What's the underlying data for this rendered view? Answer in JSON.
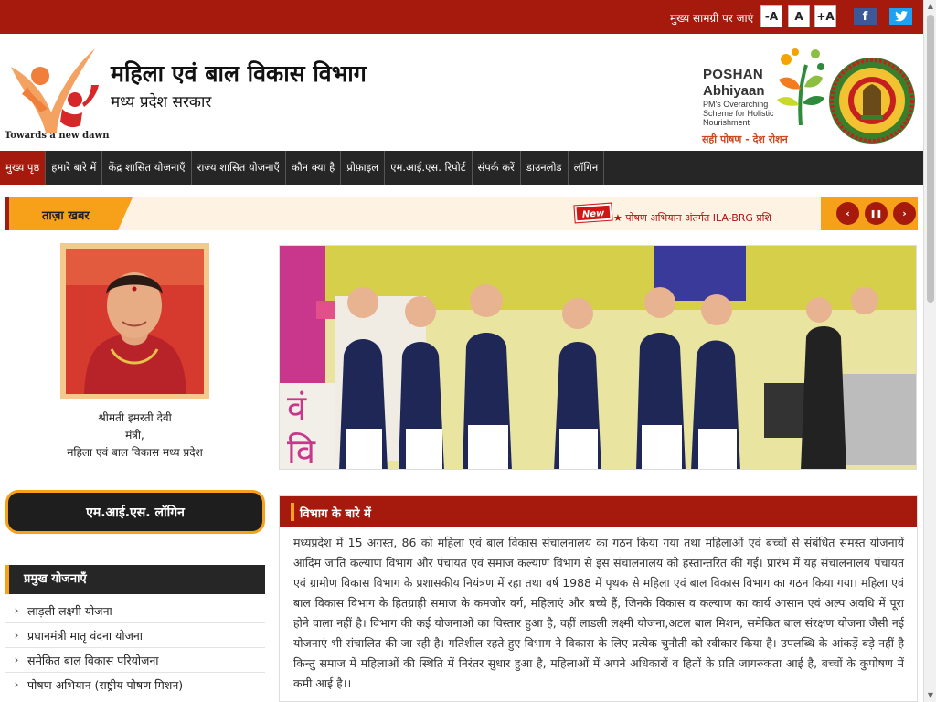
{
  "topbar": {
    "skip_link": "मुख्य सामग्री पर जाएं",
    "font_buttons": [
      "-A",
      "A",
      "+A"
    ],
    "social": [
      {
        "name": "facebook",
        "glyph": "f",
        "color": "#3b5998"
      },
      {
        "name": "twitter",
        "glyph": "t",
        "color": "#1da1f2"
      }
    ],
    "bg_color": "#a51a0c"
  },
  "header": {
    "title": "महिला एवं बाल विकास विभाग",
    "subtitle": "मध्य प्रदेश सरकार",
    "tagline": "Towards a new dawn",
    "poshan": {
      "line1": "POSHAN",
      "line2": "Abhiyaan",
      "line3": "PM's Overarching Scheme for Holistic Nourishment",
      "slogan": "सही पोषण - देश रोशन"
    }
  },
  "nav": {
    "items": [
      "मुख्य पृष्ठ",
      "हमारे बारे में",
      "केंद्र शासित योजनाएँ",
      "राज्य शासित योजनाएँ",
      "कौन क्या है",
      "प्रोफ़ाइल",
      "एम.आई.एस. रिपोर्ट",
      "संपर्क करें",
      "डाउनलोड",
      "लॉगिन"
    ],
    "active_index": 0
  },
  "ticker": {
    "label": "ताज़ा खबर",
    "badge": "New",
    "news": "★ पोषण अभियान अंतर्गत ILA-BRG प्रशि",
    "controls": [
      "‹",
      "❚❚",
      "›"
    ]
  },
  "minister": {
    "name": "श्रीमती इमरती देवी",
    "role": "मंत्री,",
    "dept": "महिला एवं बाल विकास मध्य प्रदेश"
  },
  "mis_login": "एम.आई.एस. लॉगिन",
  "schemes": {
    "heading": "प्रमुख योजनाएँ",
    "items": [
      "लाड़ली लक्ष्मी योजना",
      "प्रधानमंत्री मातृ वंदना योजना",
      "समेकित बाल विकास परियोजना",
      "पोषण अभियान (राष्ट्रीय पोषण मिशन)"
    ]
  },
  "about": {
    "heading": "विभाग के बारे में",
    "text": "मध्यप्रदेश में 15 अगस्त, 86 को महिला एवं बाल विकास संचालनालय का गठन किया गया तथा महिलाओं एवं बच्चों से संबंधित समस्त योजनायें आदिम जाति कल्याण विभाग और पंचायत एवं समाज कल्याण विभाग से इस संचालनालय को हस्तान्तरित की गई। प्रारंभ में यह संचालनालय पंचायत एवं ग्रामीण विकास विभाग के प्रशासकीय नियंत्रण में रहा तथा वर्ष 1988 में पृथक से महिला एवं बाल विकास विभाग का गठन किया गया। महिला एवं बाल विकास विभाग के हितग्राही समाज के कमजोर वर्ग, महिलाएं और बच्चे हैं, जिनके विकास व कल्याण का कार्य आसान एवं अल्प अवधि में पूरा होने वाला नहीं है। विभाग की कई योजनाओं का विस्तार हुआ है, वहीं लाडली लक्ष्मी योजना,अटल बाल मिशन, समेकित बाल संरक्षण योजना जैसी नई योजनाएं भी संचालित की जा रही है। गतिशील रहते हुए विभाग ने विकास के लिए प्रत्येक चुनौती को स्वीकार किया है। उपलब्धि के आंकड़ें बड़े नहीं है किन्तु समाज में महिलाओं की स्थिति में निरंतर सुधार हुआ है, महिलाओं में अपने अधिकारों व हितों के प्रति जागरुकता आई है, बच्चों के कुपोषण में कमी आई है।।"
  },
  "colors": {
    "primary": "#a51a0c",
    "accent": "#f7a11a",
    "dark": "#262626"
  }
}
